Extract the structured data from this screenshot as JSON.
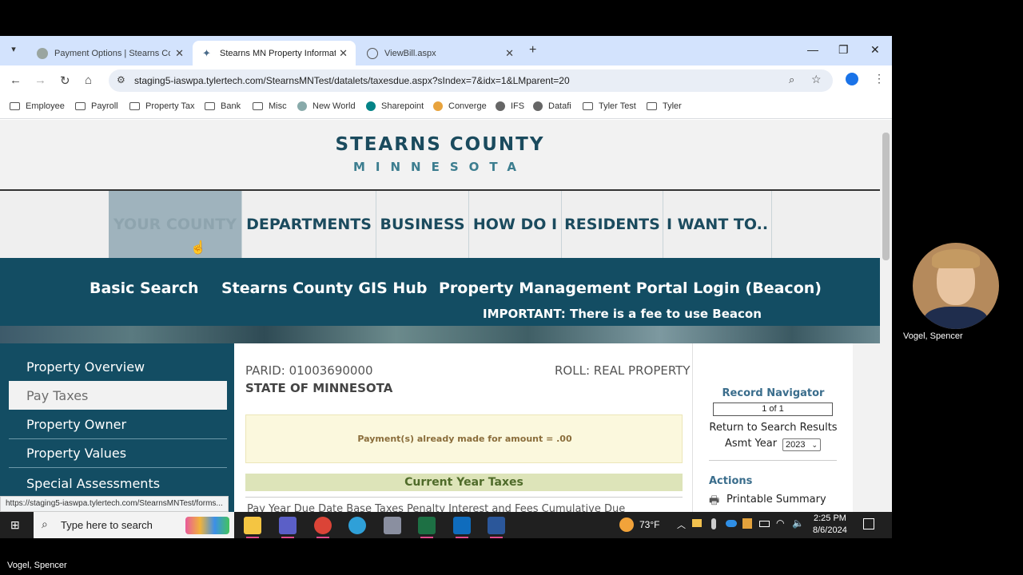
{
  "browser": {
    "tabs": [
      {
        "title": "Payment Options | Stearns Cou",
        "active": false
      },
      {
        "title": "Stearns MN Property Informati",
        "active": true
      },
      {
        "title": "ViewBill.aspx",
        "active": false
      }
    ],
    "url": "staging5-iaswpa.tylertech.com/StearnsMNTest/datalets/taxesdue.aspx?sIndex=7&idx=1&LMparent=20",
    "bookmarks": [
      "Employee",
      "Payroll",
      "Property Tax",
      "Bank",
      "Misc",
      "New World",
      "Sharepoint",
      "Converge",
      "IFS",
      "Datafi",
      "Tyler Test",
      "Tyler"
    ],
    "status_url": "https://staging5-iaswpa.tylertech.com/StearnsMNTest/forms..."
  },
  "site": {
    "logo_main": "STEARNS COUNTY",
    "logo_sub": "MINNESOTA",
    "nav": [
      "YOUR COUNTY",
      "DEPARTMENTS",
      "BUSINESS",
      "HOW DO I",
      "RESIDENTS",
      "I WANT TO.."
    ],
    "search_links": [
      "Basic Search",
      "Stearns County GIS Hub",
      "Property Management Portal Login (Beacon)"
    ],
    "fee_note": "IMPORTANT: There is a fee to use Beacon"
  },
  "sidebar": {
    "items": [
      "Property Overview",
      "Pay Taxes",
      "Property Owner",
      "Property Values",
      "Special Assessments"
    ],
    "selected": "Pay Taxes"
  },
  "parcel": {
    "parid": "PARID: 01003690000",
    "roll": "ROLL: REAL PROPERTY",
    "owner": "STATE OF MINNESOTA",
    "payment_note": "Payment(s) already made for amount = .00",
    "section_title": "Current Year Taxes",
    "table_headers_partial": "Pay Year    Due Date    Base Taxes  Penalty  Interest and Fees  Cumulative Due"
  },
  "right_panel": {
    "record_navigator": "Record Navigator",
    "record_count": "1 of 1",
    "return_link": "Return to Search Results",
    "asmt_year_label": "Asmt Year",
    "asmt_year_value": "2023",
    "actions_title": "Actions",
    "printable_summary": "Printable Summary"
  },
  "taskbar": {
    "search_placeholder": "Type here to search",
    "weather": "73°F",
    "time": "2:25 PM",
    "date": "8/6/2024"
  },
  "video": {
    "participant_name": "Vogel, Spencer",
    "self_name": "Vogel, Spencer"
  }
}
